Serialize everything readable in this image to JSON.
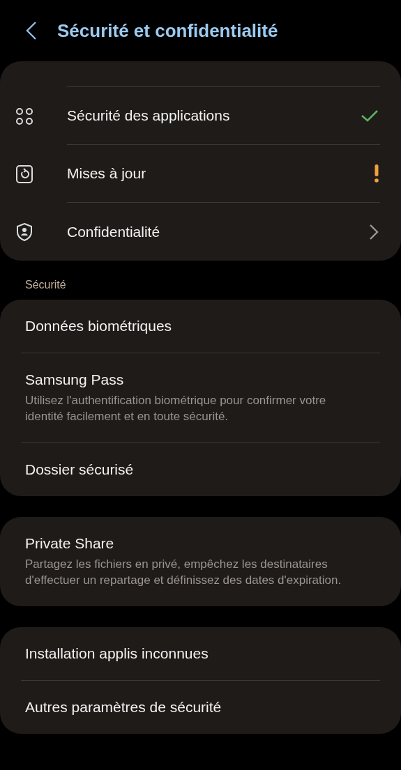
{
  "header": {
    "title": "Sécurité et confidentialité"
  },
  "top_card": {
    "items": [
      {
        "label": "Sécurité des applications",
        "kind": "check"
      },
      {
        "label": "Mises à jour",
        "kind": "alert"
      },
      {
        "label": "Confidentialité",
        "kind": "chevron"
      }
    ]
  },
  "section_label": "Sécurité",
  "cards": [
    {
      "items": [
        {
          "label": "Données biométriques"
        },
        {
          "label": "Samsung Pass",
          "description": "Utilisez l'authentification biométrique pour confirmer votre identité facilement et en toute sécurité."
        },
        {
          "label": "Dossier sécurisé"
        }
      ]
    },
    {
      "items": [
        {
          "label": "Private Share",
          "description": "Partagez les fichiers en privé, empêchez les destinataires d'effectuer un repartage et définissez des dates d'expiration."
        }
      ]
    },
    {
      "items": [
        {
          "label": "Installation applis inconnues"
        },
        {
          "label": "Autres paramètres de sécurité"
        }
      ]
    }
  ]
}
